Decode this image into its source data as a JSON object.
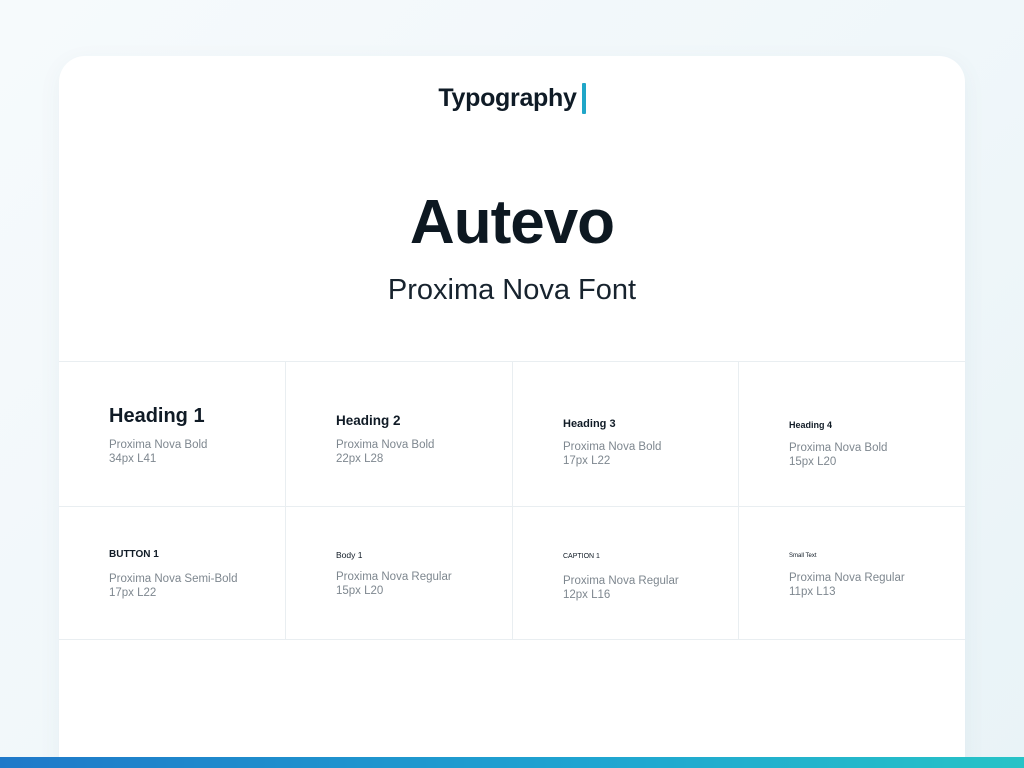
{
  "header": {
    "title": "Typography"
  },
  "hero": {
    "brand": "Autevo",
    "font": "Proxima Nova Font"
  },
  "specs": [
    {
      "name": "Heading 1",
      "weight": "Proxima Nova Bold",
      "size": "34px L41"
    },
    {
      "name": "Heading 2",
      "weight": "Proxima Nova Bold",
      "size": "22px L28"
    },
    {
      "name": "Heading 3",
      "weight": "Proxima Nova Bold",
      "size": "17px L22"
    },
    {
      "name": "Heading 4",
      "weight": "Proxima Nova Bold",
      "size": "15px L20"
    },
    {
      "name": "BUTTON 1",
      "weight": "Proxima Nova Semi-Bold",
      "size": "17px L22"
    },
    {
      "name": "Body 1",
      "weight": "Proxima Nova Regular",
      "size": "15px L20"
    },
    {
      "name": "CAPTION 1",
      "weight": "Proxima Nova Regular",
      "size": "12px L16"
    },
    {
      "name": "Small Text",
      "weight": "Proxima Nova Regular",
      "size": "11px L13"
    }
  ],
  "colors": {
    "accent": "#20a6c8",
    "text": "#0d1821",
    "muted": "#7e878f",
    "divider": "#e9eef1",
    "gradient_start": "#1f79c9",
    "gradient_end": "#27c3c7"
  }
}
